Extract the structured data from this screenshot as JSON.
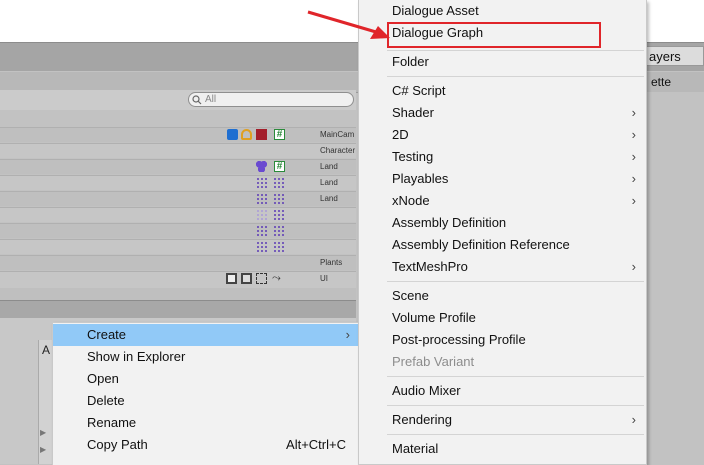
{
  "toolbar": {
    "layers_label": "ayers",
    "palette_tab": "ette"
  },
  "hierarchy": {
    "search_placeholder": "All",
    "rows": [
      {
        "layer": "MainCam"
      },
      {
        "layer": "Character"
      },
      {
        "layer": "Land"
      },
      {
        "layer": "Land"
      },
      {
        "layer": "Land"
      },
      {
        "layer": ""
      },
      {
        "layer": ""
      },
      {
        "layer": ""
      },
      {
        "layer": "Plants"
      },
      {
        "layer": "UI"
      }
    ]
  },
  "project": {
    "assets_letter": "A"
  },
  "left_menu": {
    "items": [
      {
        "label": "Create",
        "arrow": "›",
        "highlighted": true
      },
      {
        "label": "Show in Explorer"
      },
      {
        "label": "Open"
      },
      {
        "label": "Delete"
      },
      {
        "label": "Rename"
      },
      {
        "label": "Copy Path",
        "shortcut": "Alt+Ctrl+C"
      }
    ]
  },
  "right_menu": {
    "items": [
      {
        "label": "Dialogue Asset"
      },
      {
        "label": "Dialogue Graph"
      },
      {
        "label": "Folder"
      },
      {
        "label": "C# Script"
      },
      {
        "label": "Shader",
        "arrow": "›"
      },
      {
        "label": "2D",
        "arrow": "›"
      },
      {
        "label": "Testing",
        "arrow": "›"
      },
      {
        "label": "Playables",
        "arrow": "›"
      },
      {
        "label": "xNode",
        "arrow": "›"
      },
      {
        "label": "Assembly Definition"
      },
      {
        "label": "Assembly Definition Reference"
      },
      {
        "label": "TextMeshPro",
        "arrow": "›"
      },
      {
        "label": "Scene"
      },
      {
        "label": "Volume Profile"
      },
      {
        "label": "Post-processing Profile"
      },
      {
        "label": "Prefab Variant",
        "disabled": true
      },
      {
        "label": "Audio Mixer"
      },
      {
        "label": "Rendering",
        "arrow": "›"
      },
      {
        "label": "Material"
      }
    ]
  },
  "colors": {
    "highlight": "#91c9f7",
    "annotation_red": "#e0252a"
  }
}
